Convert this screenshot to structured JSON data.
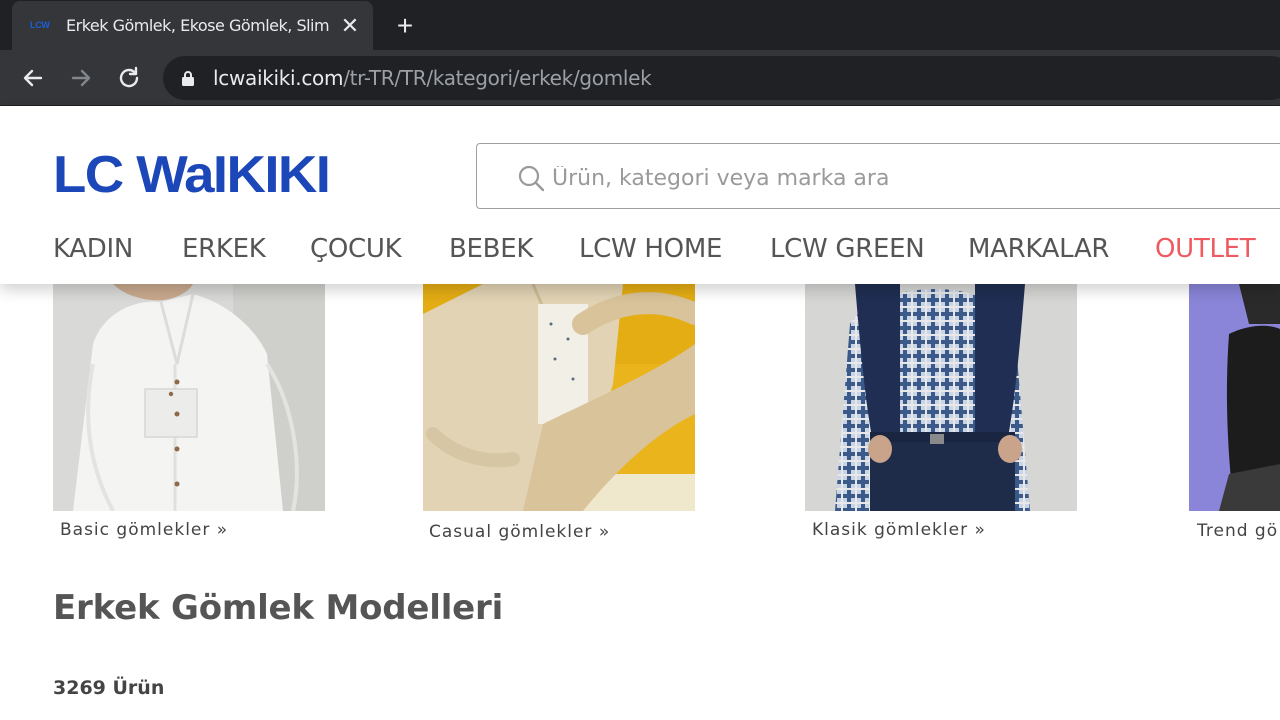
{
  "browser": {
    "tab": {
      "favicon_text": "LCW",
      "title": "Erkek Gömlek, Ekose Gömlek, Slim"
    },
    "url": {
      "host": "lcwaikiki.com",
      "path": "/tr-TR/TR/kategori/erkek/gomlek"
    }
  },
  "header": {
    "logo": "LC WAIKIKI",
    "search": {
      "placeholder": "Ürün, kategori veya marka ara",
      "value": ""
    },
    "nav": [
      "KADIN",
      "ERKEK",
      "ÇOCUK",
      "BEBEK",
      "LCW HOME",
      "LCW GREEN",
      "MARKALAR",
      "OUTLET"
    ],
    "accent_color": "#ee5a5f",
    "brand_color": "#1c47b8"
  },
  "banners": [
    {
      "label": "Basic gömlekler »"
    },
    {
      "label": "Casual gömlekler »"
    },
    {
      "label": "Klasik gömlekler »"
    },
    {
      "label": "Trend gö"
    }
  ],
  "main": {
    "title": "Erkek Gömlek Modelleri",
    "product_count": "3269 Ürün"
  }
}
